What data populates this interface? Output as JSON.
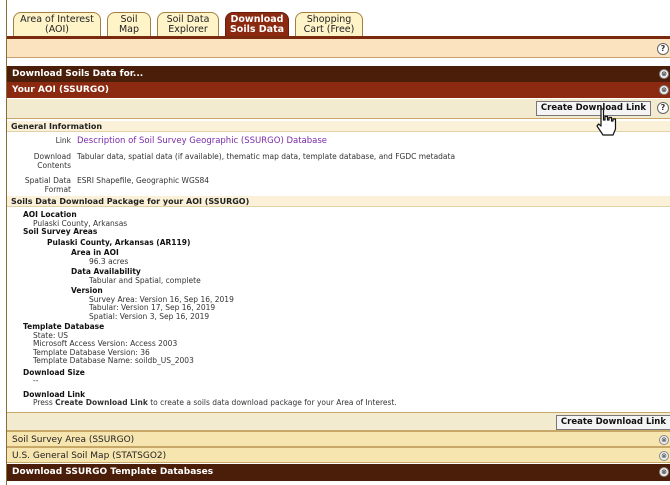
{
  "tabs": [
    {
      "line1": "Area of Interest",
      "line2": "(AOI)"
    },
    {
      "line1": "Soil",
      "line2": "Map"
    },
    {
      "line1": "Soil Data",
      "line2": "Explorer"
    },
    {
      "line1": "Download",
      "line2": "Soils Data"
    },
    {
      "line1": "Shopping",
      "line2": "Cart (Free)"
    }
  ],
  "help_glyph": "?",
  "collapse_glyph": "⊗",
  "sections": {
    "download_for": "Download Soils Data for...",
    "your_aoi": "Your AOI (SSURGO)"
  },
  "create_button": "Create Download Link",
  "general": {
    "title": "General Information",
    "link_label": "Link",
    "link_text": "Description of Soil Survey Geographic (SSURGO) Database",
    "contents_label_1": "Download",
    "contents_label_2": "Contents",
    "contents_value": "Tabular data, spatial data (if available), thematic map data, template database, and FGDC metadata",
    "format_label_1": "Spatial Data",
    "format_label_2": "Format",
    "format_value": "ESRI Shapefile, Geographic WGS84"
  },
  "package": {
    "title": "Soils Data Download Package for your AOI (SSURGO)",
    "aoi_location_label": "AOI Location",
    "aoi_location_value": "Pulaski County, Arkansas",
    "soil_survey_areas_label": "Soil Survey Areas",
    "survey_area_name": "Pulaski County, Arkansas (AR119)",
    "area_label": "Area in AOI",
    "area_value": "96.3 acres",
    "availability_label": "Data Availability",
    "availability_value": "Tabular and Spatial, complete",
    "version_label": "Version",
    "version_survey": "Survey Area: Version 16, Sep 16, 2019",
    "version_tabular": "Tabular: Version 17, Sep 16, 2019",
    "version_spatial": "Spatial: Version 3, Sep 16, 2019",
    "template_label": "Template Database",
    "template_state": "State: US",
    "template_access": "Microsoft Access Version: Access 2003",
    "template_version": "Template Database Version: 36",
    "template_name": "Template Database Name: soildb_US_2003",
    "size_label": "Download Size",
    "size_value": "--",
    "dl_label": "Download Link",
    "dl_text_pre": "Press ",
    "dl_text_bold": "Create Download Link",
    "dl_text_post": " to create a soils data download package for your Area of Interest."
  },
  "bottom_sections": {
    "ssa": "Soil Survey Area (SSURGO)",
    "statsgo": "U.S. General Soil Map (STATSGO2)",
    "templates": "Download SSURGO Template Databases"
  }
}
